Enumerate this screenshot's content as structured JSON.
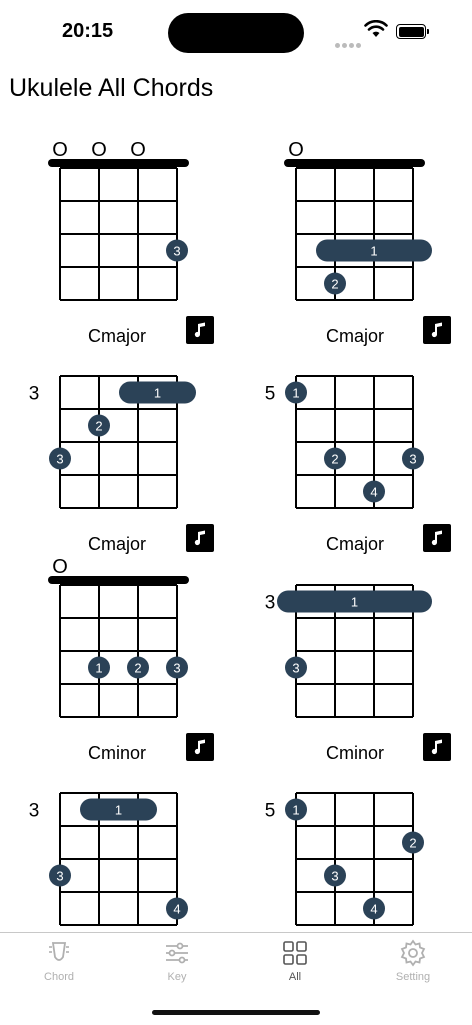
{
  "status": {
    "time": "20:15"
  },
  "page": {
    "title": "Ukulele All Chords"
  },
  "chords": [
    {
      "name": "Cmajor",
      "base_fret": "",
      "open": [
        "O",
        "O",
        "O",
        ""
      ],
      "nut": true,
      "dots": [
        {
          "string": 4,
          "fret": 3,
          "finger": "3"
        }
      ],
      "barre": null
    },
    {
      "name": "Cmajor",
      "base_fret": "",
      "open": [
        "O",
        "",
        "",
        ""
      ],
      "nut": true,
      "dots": [
        {
          "string": 2,
          "fret": 4,
          "finger": "2"
        }
      ],
      "barre": {
        "fret": 3,
        "from": 2,
        "to": 4,
        "finger": "1"
      }
    },
    {
      "name": "Cmajor",
      "base_fret": "3",
      "open": [
        "",
        "",
        "",
        ""
      ],
      "nut": false,
      "dots": [
        {
          "string": 2,
          "fret": 2,
          "finger": "2"
        },
        {
          "string": 1,
          "fret": 3,
          "finger": "3"
        }
      ],
      "barre": {
        "fret": 1,
        "from": 3,
        "to": 4,
        "finger": "1"
      }
    },
    {
      "name": "Cmajor",
      "base_fret": "5",
      "open": [
        "",
        "",
        "",
        ""
      ],
      "nut": false,
      "dots": [
        {
          "string": 1,
          "fret": 1,
          "finger": "1"
        },
        {
          "string": 2,
          "fret": 3,
          "finger": "2"
        },
        {
          "string": 4,
          "fret": 3,
          "finger": "3"
        },
        {
          "string": 3,
          "fret": 4,
          "finger": "4"
        }
      ],
      "barre": null
    },
    {
      "name": "Cminor",
      "base_fret": "",
      "open": [
        "O",
        "",
        "",
        ""
      ],
      "nut": true,
      "dots": [
        {
          "string": 2,
          "fret": 3,
          "finger": "1"
        },
        {
          "string": 3,
          "fret": 3,
          "finger": "2"
        },
        {
          "string": 4,
          "fret": 3,
          "finger": "3"
        }
      ],
      "barre": null
    },
    {
      "name": "Cminor",
      "base_fret": "3",
      "open": [
        "",
        "",
        "",
        ""
      ],
      "nut": false,
      "dots": [
        {
          "string": 1,
          "fret": 3,
          "finger": "3"
        }
      ],
      "barre": {
        "fret": 1,
        "from": 1,
        "to": 4,
        "finger": "1"
      }
    },
    {
      "name": "",
      "base_fret": "3",
      "open": [
        "",
        "",
        "",
        ""
      ],
      "nut": false,
      "dots": [
        {
          "string": 1,
          "fret": 3,
          "finger": "3"
        },
        {
          "string": 4,
          "fret": 4,
          "finger": "4"
        }
      ],
      "barre": {
        "fret": 1,
        "from": 2,
        "to": 3,
        "finger": "1"
      }
    },
    {
      "name": "",
      "base_fret": "5",
      "open": [
        "",
        "",
        "",
        ""
      ],
      "nut": false,
      "dots": [
        {
          "string": 1,
          "fret": 1,
          "finger": "1"
        },
        {
          "string": 4,
          "fret": 2,
          "finger": "2"
        },
        {
          "string": 2,
          "fret": 3,
          "finger": "3"
        },
        {
          "string": 3,
          "fret": 4,
          "finger": "4"
        }
      ],
      "barre": null
    }
  ],
  "tabs": [
    {
      "label": "Chord",
      "icon": "guitar-pick-icon",
      "active": false
    },
    {
      "label": "Key",
      "icon": "sliders-icon",
      "active": false
    },
    {
      "label": "All",
      "icon": "grid-icon",
      "active": true
    },
    {
      "label": "Setting",
      "icon": "gear-icon",
      "active": false
    }
  ],
  "colors": {
    "dot": "#2b4257",
    "inactive_tab": "#b0b0b0",
    "active_tab": "#555555"
  }
}
